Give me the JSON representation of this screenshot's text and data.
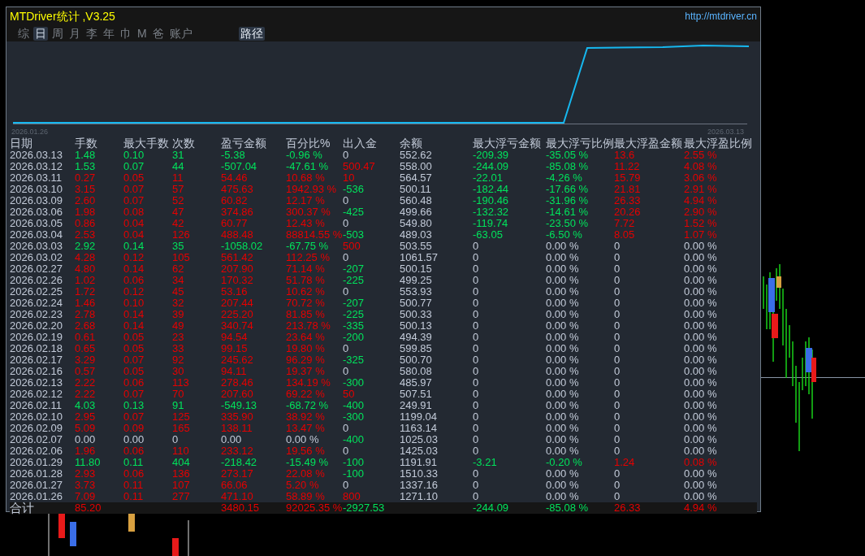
{
  "window": {
    "title": "MTDriver统计 ,V3.25",
    "link": "http://mtdriver.cn"
  },
  "tabs": [
    {
      "label": "综",
      "selected": false
    },
    {
      "label": "日",
      "selected": true
    },
    {
      "label": "周",
      "selected": false
    },
    {
      "label": "月",
      "selected": false
    },
    {
      "label": "李",
      "selected": false
    },
    {
      "label": "年",
      "selected": false
    },
    {
      "label": "巾",
      "selected": false
    },
    {
      "label": "M",
      "selected": false
    },
    {
      "label": "爸",
      "selected": false
    },
    {
      "label": "账户",
      "selected": false
    }
  ],
  "path_button": "路径",
  "equity_chart": {
    "start_label": "2026.01.26",
    "end_label": "2026.03.13"
  },
  "table": {
    "columns": [
      "日期",
      "手数",
      "最大手数",
      "次数",
      "盈亏金额",
      "百分比%",
      "出入金",
      "余额",
      "最大浮亏金额",
      "最大浮亏比例",
      "最大浮盈金额",
      "最大浮盈比例"
    ],
    "rows": [
      [
        {
          "text": "2026.03.13",
          "color": "#c3cbd9"
        },
        {
          "text": "1.48",
          "color": "#00e35c"
        },
        {
          "text": "0.10",
          "color": "#00e35c"
        },
        {
          "text": "31",
          "color": "#00e35c"
        },
        {
          "text": "-5.38",
          "color": "#00e35c"
        },
        {
          "text": "-0.96 %",
          "color": "#00e35c"
        },
        {
          "text": "0",
          "color": "#c3cbd9"
        },
        {
          "text": "552.62",
          "color": "#c3cbd9"
        },
        {
          "text": "-209.39",
          "color": "#00e35c"
        },
        {
          "text": "-35.05 %",
          "color": "#00e35c"
        },
        {
          "text": "13.6",
          "color": "#e60000"
        },
        {
          "text": "2.55 %",
          "color": "#e60000"
        }
      ],
      [
        {
          "text": "2026.03.12",
          "color": "#c3cbd9"
        },
        {
          "text": "1.53",
          "color": "#00e35c"
        },
        {
          "text": "0.07",
          "color": "#00e35c"
        },
        {
          "text": "44",
          "color": "#00e35c"
        },
        {
          "text": "-507.04",
          "color": "#00e35c"
        },
        {
          "text": "-47.61 %",
          "color": "#00e35c"
        },
        {
          "text": "500.47",
          "color": "#e60000"
        },
        {
          "text": "558.00",
          "color": "#c3cbd9"
        },
        {
          "text": "-244.09",
          "color": "#00e35c"
        },
        {
          "text": "-85.08 %",
          "color": "#00e35c"
        },
        {
          "text": "11.22",
          "color": "#e60000"
        },
        {
          "text": "4.08 %",
          "color": "#e60000"
        }
      ],
      [
        {
          "text": "2026.03.11",
          "color": "#c3cbd9"
        },
        {
          "text": "0.27",
          "color": "#e60000"
        },
        {
          "text": "0.05",
          "color": "#e60000"
        },
        {
          "text": "11",
          "color": "#e60000"
        },
        {
          "text": "54.46",
          "color": "#e60000"
        },
        {
          "text": "10.68 %",
          "color": "#e60000"
        },
        {
          "text": "10",
          "color": "#e60000"
        },
        {
          "text": "564.57",
          "color": "#c3cbd9"
        },
        {
          "text": "-22.01",
          "color": "#00e35c"
        },
        {
          "text": "-4.26 %",
          "color": "#00e35c"
        },
        {
          "text": "15.79",
          "color": "#e60000"
        },
        {
          "text": "3.06 %",
          "color": "#e60000"
        }
      ],
      [
        {
          "text": "2026.03.10",
          "color": "#c3cbd9"
        },
        {
          "text": "3.15",
          "color": "#e60000"
        },
        {
          "text": "0.07",
          "color": "#e60000"
        },
        {
          "text": "57",
          "color": "#e60000"
        },
        {
          "text": "475.63",
          "color": "#e60000"
        },
        {
          "text": "1942.93 %",
          "color": "#e60000"
        },
        {
          "text": "-536",
          "color": "#00e35c"
        },
        {
          "text": "500.11",
          "color": "#c3cbd9"
        },
        {
          "text": "-182.44",
          "color": "#00e35c"
        },
        {
          "text": "-17.66 %",
          "color": "#00e35c"
        },
        {
          "text": "21.81",
          "color": "#e60000"
        },
        {
          "text": "2.91 %",
          "color": "#e60000"
        }
      ],
      [
        {
          "text": "2026.03.09",
          "color": "#c3cbd9"
        },
        {
          "text": "2.60",
          "color": "#e60000"
        },
        {
          "text": "0.07",
          "color": "#e60000"
        },
        {
          "text": "52",
          "color": "#e60000"
        },
        {
          "text": "60.82",
          "color": "#e60000"
        },
        {
          "text": "12.17 %",
          "color": "#e60000"
        },
        {
          "text": "0",
          "color": "#c3cbd9"
        },
        {
          "text": "560.48",
          "color": "#c3cbd9"
        },
        {
          "text": "-190.46",
          "color": "#00e35c"
        },
        {
          "text": "-31.96 %",
          "color": "#00e35c"
        },
        {
          "text": "26.33",
          "color": "#e60000"
        },
        {
          "text": "4.94 %",
          "color": "#e60000"
        }
      ],
      [
        {
          "text": "2026.03.06",
          "color": "#c3cbd9"
        },
        {
          "text": "1.98",
          "color": "#e60000"
        },
        {
          "text": "0.08",
          "color": "#e60000"
        },
        {
          "text": "47",
          "color": "#e60000"
        },
        {
          "text": "374.86",
          "color": "#e60000"
        },
        {
          "text": "300.37 %",
          "color": "#e60000"
        },
        {
          "text": "-425",
          "color": "#00e35c"
        },
        {
          "text": "499.66",
          "color": "#c3cbd9"
        },
        {
          "text": "-132.32",
          "color": "#00e35c"
        },
        {
          "text": "-14.61 %",
          "color": "#00e35c"
        },
        {
          "text": "20.26",
          "color": "#e60000"
        },
        {
          "text": "2.90 %",
          "color": "#e60000"
        }
      ],
      [
        {
          "text": "2026.03.05",
          "color": "#c3cbd9"
        },
        {
          "text": "0.86",
          "color": "#e60000"
        },
        {
          "text": "0.04",
          "color": "#e60000"
        },
        {
          "text": "42",
          "color": "#e60000"
        },
        {
          "text": "60.77",
          "color": "#e60000"
        },
        {
          "text": "12.43 %",
          "color": "#e60000"
        },
        {
          "text": "0",
          "color": "#c3cbd9"
        },
        {
          "text": "549.80",
          "color": "#c3cbd9"
        },
        {
          "text": "-119.74",
          "color": "#00e35c"
        },
        {
          "text": "-23.50 %",
          "color": "#00e35c"
        },
        {
          "text": "7.72",
          "color": "#e60000"
        },
        {
          "text": "1.52 %",
          "color": "#e60000"
        }
      ],
      [
        {
          "text": "2026.03.04",
          "color": "#c3cbd9"
        },
        {
          "text": "2.53",
          "color": "#e60000"
        },
        {
          "text": "0.04",
          "color": "#e60000"
        },
        {
          "text": "126",
          "color": "#e60000"
        },
        {
          "text": "488.48",
          "color": "#e60000"
        },
        {
          "text": "88814.55 %",
          "color": "#e60000"
        },
        {
          "text": "-503",
          "color": "#00e35c"
        },
        {
          "text": "489.03",
          "color": "#c3cbd9"
        },
        {
          "text": "-63.05",
          "color": "#00e35c"
        },
        {
          "text": "-6.50 %",
          "color": "#00e35c"
        },
        {
          "text": "8.05",
          "color": "#e60000"
        },
        {
          "text": "1.07 %",
          "color": "#e60000"
        }
      ],
      [
        {
          "text": "2026.03.03",
          "color": "#c3cbd9"
        },
        {
          "text": "2.92",
          "color": "#00e35c"
        },
        {
          "text": "0.14",
          "color": "#00e35c"
        },
        {
          "text": "35",
          "color": "#00e35c"
        },
        {
          "text": "-1058.02",
          "color": "#00e35c"
        },
        {
          "text": "-67.75 %",
          "color": "#00e35c"
        },
        {
          "text": "500",
          "color": "#e60000"
        },
        {
          "text": "503.55",
          "color": "#c3cbd9"
        },
        {
          "text": "0",
          "color": "#c3cbd9"
        },
        {
          "text": "0.00 %",
          "color": "#c3cbd9"
        },
        {
          "text": "0",
          "color": "#c3cbd9"
        },
        {
          "text": "0.00 %",
          "color": "#c3cbd9"
        }
      ],
      [
        {
          "text": "2026.03.02",
          "color": "#c3cbd9"
        },
        {
          "text": "4.28",
          "color": "#e60000"
        },
        {
          "text": "0.12",
          "color": "#e60000"
        },
        {
          "text": "105",
          "color": "#e60000"
        },
        {
          "text": "561.42",
          "color": "#e60000"
        },
        {
          "text": "112.25 %",
          "color": "#e60000"
        },
        {
          "text": "0",
          "color": "#c3cbd9"
        },
        {
          "text": "1061.57",
          "color": "#c3cbd9"
        },
        {
          "text": "0",
          "color": "#c3cbd9"
        },
        {
          "text": "0.00 %",
          "color": "#c3cbd9"
        },
        {
          "text": "0",
          "color": "#c3cbd9"
        },
        {
          "text": "0.00 %",
          "color": "#c3cbd9"
        }
      ],
      [
        {
          "text": "2026.02.27",
          "color": "#c3cbd9"
        },
        {
          "text": "4.80",
          "color": "#e60000"
        },
        {
          "text": "0.14",
          "color": "#e60000"
        },
        {
          "text": "62",
          "color": "#e60000"
        },
        {
          "text": "207.90",
          "color": "#e60000"
        },
        {
          "text": "71.14 %",
          "color": "#e60000"
        },
        {
          "text": "-207",
          "color": "#00e35c"
        },
        {
          "text": "500.15",
          "color": "#c3cbd9"
        },
        {
          "text": "0",
          "color": "#c3cbd9"
        },
        {
          "text": "0.00 %",
          "color": "#c3cbd9"
        },
        {
          "text": "0",
          "color": "#c3cbd9"
        },
        {
          "text": "0.00 %",
          "color": "#c3cbd9"
        }
      ],
      [
        {
          "text": "2026.02.26",
          "color": "#c3cbd9"
        },
        {
          "text": "1.02",
          "color": "#e60000"
        },
        {
          "text": "0.06",
          "color": "#e60000"
        },
        {
          "text": "34",
          "color": "#e60000"
        },
        {
          "text": "170.32",
          "color": "#e60000"
        },
        {
          "text": "51.78 %",
          "color": "#e60000"
        },
        {
          "text": "-225",
          "color": "#00e35c"
        },
        {
          "text": "499.25",
          "color": "#c3cbd9"
        },
        {
          "text": "0",
          "color": "#c3cbd9"
        },
        {
          "text": "0.00 %",
          "color": "#c3cbd9"
        },
        {
          "text": "0",
          "color": "#c3cbd9"
        },
        {
          "text": "0.00 %",
          "color": "#c3cbd9"
        }
      ],
      [
        {
          "text": "2026.02.25",
          "color": "#c3cbd9"
        },
        {
          "text": "1.72",
          "color": "#e60000"
        },
        {
          "text": "0.12",
          "color": "#e60000"
        },
        {
          "text": "45",
          "color": "#e60000"
        },
        {
          "text": "53.16",
          "color": "#e60000"
        },
        {
          "text": "10.62 %",
          "color": "#e60000"
        },
        {
          "text": "0",
          "color": "#c3cbd9"
        },
        {
          "text": "553.93",
          "color": "#c3cbd9"
        },
        {
          "text": "0",
          "color": "#c3cbd9"
        },
        {
          "text": "0.00 %",
          "color": "#c3cbd9"
        },
        {
          "text": "0",
          "color": "#c3cbd9"
        },
        {
          "text": "0.00 %",
          "color": "#c3cbd9"
        }
      ],
      [
        {
          "text": "2026.02.24",
          "color": "#c3cbd9"
        },
        {
          "text": "1.46",
          "color": "#e60000"
        },
        {
          "text": "0.10",
          "color": "#e60000"
        },
        {
          "text": "32",
          "color": "#e60000"
        },
        {
          "text": "207.44",
          "color": "#e60000"
        },
        {
          "text": "70.72 %",
          "color": "#e60000"
        },
        {
          "text": "-207",
          "color": "#00e35c"
        },
        {
          "text": "500.77",
          "color": "#c3cbd9"
        },
        {
          "text": "0",
          "color": "#c3cbd9"
        },
        {
          "text": "0.00 %",
          "color": "#c3cbd9"
        },
        {
          "text": "0",
          "color": "#c3cbd9"
        },
        {
          "text": "0.00 %",
          "color": "#c3cbd9"
        }
      ],
      [
        {
          "text": "2026.02.23",
          "color": "#c3cbd9"
        },
        {
          "text": "2.78",
          "color": "#e60000"
        },
        {
          "text": "0.14",
          "color": "#e60000"
        },
        {
          "text": "39",
          "color": "#e60000"
        },
        {
          "text": "225.20",
          "color": "#e60000"
        },
        {
          "text": "81.85 %",
          "color": "#e60000"
        },
        {
          "text": "-225",
          "color": "#00e35c"
        },
        {
          "text": "500.33",
          "color": "#c3cbd9"
        },
        {
          "text": "0",
          "color": "#c3cbd9"
        },
        {
          "text": "0.00 %",
          "color": "#c3cbd9"
        },
        {
          "text": "0",
          "color": "#c3cbd9"
        },
        {
          "text": "0.00 %",
          "color": "#c3cbd9"
        }
      ],
      [
        {
          "text": "2026.02.20",
          "color": "#c3cbd9"
        },
        {
          "text": "2.68",
          "color": "#e60000"
        },
        {
          "text": "0.14",
          "color": "#e60000"
        },
        {
          "text": "49",
          "color": "#e60000"
        },
        {
          "text": "340.74",
          "color": "#e60000"
        },
        {
          "text": "213.78 %",
          "color": "#e60000"
        },
        {
          "text": "-335",
          "color": "#00e35c"
        },
        {
          "text": "500.13",
          "color": "#c3cbd9"
        },
        {
          "text": "0",
          "color": "#c3cbd9"
        },
        {
          "text": "0.00 %",
          "color": "#c3cbd9"
        },
        {
          "text": "0",
          "color": "#c3cbd9"
        },
        {
          "text": "0.00 %",
          "color": "#c3cbd9"
        }
      ],
      [
        {
          "text": "2026.02.19",
          "color": "#c3cbd9"
        },
        {
          "text": "0.61",
          "color": "#e60000"
        },
        {
          "text": "0.05",
          "color": "#e60000"
        },
        {
          "text": "23",
          "color": "#e60000"
        },
        {
          "text": "94.54",
          "color": "#e60000"
        },
        {
          "text": "23.64 %",
          "color": "#e60000"
        },
        {
          "text": "-200",
          "color": "#00e35c"
        },
        {
          "text": "494.39",
          "color": "#c3cbd9"
        },
        {
          "text": "0",
          "color": "#c3cbd9"
        },
        {
          "text": "0.00 %",
          "color": "#c3cbd9"
        },
        {
          "text": "0",
          "color": "#c3cbd9"
        },
        {
          "text": "0.00 %",
          "color": "#c3cbd9"
        }
      ],
      [
        {
          "text": "2026.02.18",
          "color": "#c3cbd9"
        },
        {
          "text": "0.65",
          "color": "#e60000"
        },
        {
          "text": "0.05",
          "color": "#e60000"
        },
        {
          "text": "33",
          "color": "#e60000"
        },
        {
          "text": "99.15",
          "color": "#e60000"
        },
        {
          "text": "19.80 %",
          "color": "#e60000"
        },
        {
          "text": "0",
          "color": "#c3cbd9"
        },
        {
          "text": "599.85",
          "color": "#c3cbd9"
        },
        {
          "text": "0",
          "color": "#c3cbd9"
        },
        {
          "text": "0.00 %",
          "color": "#c3cbd9"
        },
        {
          "text": "0",
          "color": "#c3cbd9"
        },
        {
          "text": "0.00 %",
          "color": "#c3cbd9"
        }
      ],
      [
        {
          "text": "2026.02.17",
          "color": "#c3cbd9"
        },
        {
          "text": "3.29",
          "color": "#e60000"
        },
        {
          "text": "0.07",
          "color": "#e60000"
        },
        {
          "text": "92",
          "color": "#e60000"
        },
        {
          "text": "245.62",
          "color": "#e60000"
        },
        {
          "text": "96.29 %",
          "color": "#e60000"
        },
        {
          "text": "-325",
          "color": "#00e35c"
        },
        {
          "text": "500.70",
          "color": "#c3cbd9"
        },
        {
          "text": "0",
          "color": "#c3cbd9"
        },
        {
          "text": "0.00 %",
          "color": "#c3cbd9"
        },
        {
          "text": "0",
          "color": "#c3cbd9"
        },
        {
          "text": "0.00 %",
          "color": "#c3cbd9"
        }
      ],
      [
        {
          "text": "2026.02.16",
          "color": "#c3cbd9"
        },
        {
          "text": "0.57",
          "color": "#e60000"
        },
        {
          "text": "0.05",
          "color": "#e60000"
        },
        {
          "text": "30",
          "color": "#e60000"
        },
        {
          "text": "94.11",
          "color": "#e60000"
        },
        {
          "text": "19.37 %",
          "color": "#e60000"
        },
        {
          "text": "0",
          "color": "#c3cbd9"
        },
        {
          "text": "580.08",
          "color": "#c3cbd9"
        },
        {
          "text": "0",
          "color": "#c3cbd9"
        },
        {
          "text": "0.00 %",
          "color": "#c3cbd9"
        },
        {
          "text": "0",
          "color": "#c3cbd9"
        },
        {
          "text": "0.00 %",
          "color": "#c3cbd9"
        }
      ],
      [
        {
          "text": "2026.02.13",
          "color": "#c3cbd9"
        },
        {
          "text": "2.22",
          "color": "#e60000"
        },
        {
          "text": "0.06",
          "color": "#e60000"
        },
        {
          "text": "113",
          "color": "#e60000"
        },
        {
          "text": "278.46",
          "color": "#e60000"
        },
        {
          "text": "134.19 %",
          "color": "#e60000"
        },
        {
          "text": "-300",
          "color": "#00e35c"
        },
        {
          "text": "485.97",
          "color": "#c3cbd9"
        },
        {
          "text": "0",
          "color": "#c3cbd9"
        },
        {
          "text": "0.00 %",
          "color": "#c3cbd9"
        },
        {
          "text": "0",
          "color": "#c3cbd9"
        },
        {
          "text": "0.00 %",
          "color": "#c3cbd9"
        }
      ],
      [
        {
          "text": "2026.02.12",
          "color": "#c3cbd9"
        },
        {
          "text": "2.22",
          "color": "#e60000"
        },
        {
          "text": "0.07",
          "color": "#e60000"
        },
        {
          "text": "70",
          "color": "#e60000"
        },
        {
          "text": "207.60",
          "color": "#e60000"
        },
        {
          "text": "69.22 %",
          "color": "#e60000"
        },
        {
          "text": "50",
          "color": "#e60000"
        },
        {
          "text": "507.51",
          "color": "#c3cbd9"
        },
        {
          "text": "0",
          "color": "#c3cbd9"
        },
        {
          "text": "0.00 %",
          "color": "#c3cbd9"
        },
        {
          "text": "0",
          "color": "#c3cbd9"
        },
        {
          "text": "0.00 %",
          "color": "#c3cbd9"
        }
      ],
      [
        {
          "text": "2026.02.11",
          "color": "#c3cbd9"
        },
        {
          "text": "4.03",
          "color": "#00e35c"
        },
        {
          "text": "0.13",
          "color": "#00e35c"
        },
        {
          "text": "91",
          "color": "#00e35c"
        },
        {
          "text": "-549.13",
          "color": "#00e35c"
        },
        {
          "text": "-68.72 %",
          "color": "#00e35c"
        },
        {
          "text": "-400",
          "color": "#00e35c"
        },
        {
          "text": "249.91",
          "color": "#c3cbd9"
        },
        {
          "text": "0",
          "color": "#c3cbd9"
        },
        {
          "text": "0.00 %",
          "color": "#c3cbd9"
        },
        {
          "text": "0",
          "color": "#c3cbd9"
        },
        {
          "text": "0.00 %",
          "color": "#c3cbd9"
        }
      ],
      [
        {
          "text": "2026.02.10",
          "color": "#c3cbd9"
        },
        {
          "text": "2.95",
          "color": "#e60000"
        },
        {
          "text": "0.07",
          "color": "#e60000"
        },
        {
          "text": "125",
          "color": "#e60000"
        },
        {
          "text": "335.90",
          "color": "#e60000"
        },
        {
          "text": "38.92 %",
          "color": "#e60000"
        },
        {
          "text": "-300",
          "color": "#00e35c"
        },
        {
          "text": "1199.04",
          "color": "#c3cbd9"
        },
        {
          "text": "0",
          "color": "#c3cbd9"
        },
        {
          "text": "0.00 %",
          "color": "#c3cbd9"
        },
        {
          "text": "0",
          "color": "#c3cbd9"
        },
        {
          "text": "0.00 %",
          "color": "#c3cbd9"
        }
      ],
      [
        {
          "text": "2026.02.09",
          "color": "#c3cbd9"
        },
        {
          "text": "5.09",
          "color": "#e60000"
        },
        {
          "text": "0.09",
          "color": "#e60000"
        },
        {
          "text": "165",
          "color": "#e60000"
        },
        {
          "text": "138.11",
          "color": "#e60000"
        },
        {
          "text": "13.47 %",
          "color": "#e60000"
        },
        {
          "text": "0",
          "color": "#c3cbd9"
        },
        {
          "text": "1163.14",
          "color": "#c3cbd9"
        },
        {
          "text": "0",
          "color": "#c3cbd9"
        },
        {
          "text": "0.00 %",
          "color": "#c3cbd9"
        },
        {
          "text": "0",
          "color": "#c3cbd9"
        },
        {
          "text": "0.00 %",
          "color": "#c3cbd9"
        }
      ],
      [
        {
          "text": "2026.02.07",
          "color": "#c3cbd9"
        },
        {
          "text": "0.00",
          "color": "#c3cbd9"
        },
        {
          "text": "0.00",
          "color": "#c3cbd9"
        },
        {
          "text": "0",
          "color": "#c3cbd9"
        },
        {
          "text": "0.00",
          "color": "#c3cbd9"
        },
        {
          "text": "0.00 %",
          "color": "#c3cbd9"
        },
        {
          "text": "-400",
          "color": "#00e35c"
        },
        {
          "text": "1025.03",
          "color": "#c3cbd9"
        },
        {
          "text": "0",
          "color": "#c3cbd9"
        },
        {
          "text": "0.00 %",
          "color": "#c3cbd9"
        },
        {
          "text": "0",
          "color": "#c3cbd9"
        },
        {
          "text": "0.00 %",
          "color": "#c3cbd9"
        }
      ],
      [
        {
          "text": "2026.02.06",
          "color": "#c3cbd9"
        },
        {
          "text": "1.96",
          "color": "#e60000"
        },
        {
          "text": "0.06",
          "color": "#e60000"
        },
        {
          "text": "110",
          "color": "#e60000"
        },
        {
          "text": "233.12",
          "color": "#e60000"
        },
        {
          "text": "19.56 %",
          "color": "#e60000"
        },
        {
          "text": "0",
          "color": "#c3cbd9"
        },
        {
          "text": "1425.03",
          "color": "#c3cbd9"
        },
        {
          "text": "0",
          "color": "#c3cbd9"
        },
        {
          "text": "0.00 %",
          "color": "#c3cbd9"
        },
        {
          "text": "0",
          "color": "#c3cbd9"
        },
        {
          "text": "0.00 %",
          "color": "#c3cbd9"
        }
      ],
      [
        {
          "text": "2026.01.29",
          "color": "#c3cbd9"
        },
        {
          "text": "11.80",
          "color": "#00e35c"
        },
        {
          "text": "0.11",
          "color": "#00e35c"
        },
        {
          "text": "404",
          "color": "#00e35c"
        },
        {
          "text": "-218.42",
          "color": "#00e35c"
        },
        {
          "text": "-15.49 %",
          "color": "#00e35c"
        },
        {
          "text": "-100",
          "color": "#00e35c"
        },
        {
          "text": "1191.91",
          "color": "#c3cbd9"
        },
        {
          "text": "-3.21",
          "color": "#00e35c"
        },
        {
          "text": "-0.20 %",
          "color": "#00e35c"
        },
        {
          "text": "1.24",
          "color": "#e60000"
        },
        {
          "text": "0.08 %",
          "color": "#e60000"
        }
      ],
      [
        {
          "text": "2026.01.28",
          "color": "#c3cbd9"
        },
        {
          "text": "2.93",
          "color": "#e60000"
        },
        {
          "text": "0.06",
          "color": "#e60000"
        },
        {
          "text": "136",
          "color": "#e60000"
        },
        {
          "text": "273.17",
          "color": "#e60000"
        },
        {
          "text": "22.08 %",
          "color": "#e60000"
        },
        {
          "text": "-100",
          "color": "#00e35c"
        },
        {
          "text": "1510.33",
          "color": "#c3cbd9"
        },
        {
          "text": "0",
          "color": "#c3cbd9"
        },
        {
          "text": "0.00 %",
          "color": "#c3cbd9"
        },
        {
          "text": "0",
          "color": "#c3cbd9"
        },
        {
          "text": "0.00 %",
          "color": "#c3cbd9"
        }
      ],
      [
        {
          "text": "2026.01.27",
          "color": "#c3cbd9"
        },
        {
          "text": "3.73",
          "color": "#e60000"
        },
        {
          "text": "0.11",
          "color": "#e60000"
        },
        {
          "text": "107",
          "color": "#e60000"
        },
        {
          "text": "66.06",
          "color": "#e60000"
        },
        {
          "text": "5.20 %",
          "color": "#e60000"
        },
        {
          "text": "0",
          "color": "#c3cbd9"
        },
        {
          "text": "1337.16",
          "color": "#c3cbd9"
        },
        {
          "text": "0",
          "color": "#c3cbd9"
        },
        {
          "text": "0.00 %",
          "color": "#c3cbd9"
        },
        {
          "text": "0",
          "color": "#c3cbd9"
        },
        {
          "text": "0.00 %",
          "color": "#c3cbd9"
        }
      ],
      [
        {
          "text": "2026.01.26",
          "color": "#c3cbd9"
        },
        {
          "text": "7.09",
          "color": "#e60000"
        },
        {
          "text": "0.11",
          "color": "#e60000"
        },
        {
          "text": "277",
          "color": "#e60000"
        },
        {
          "text": "471.10",
          "color": "#e60000"
        },
        {
          "text": "58.89 %",
          "color": "#e60000"
        },
        {
          "text": "800",
          "color": "#e60000"
        },
        {
          "text": "1271.10",
          "color": "#c3cbd9"
        },
        {
          "text": "0",
          "color": "#c3cbd9"
        },
        {
          "text": "0.00 %",
          "color": "#c3cbd9"
        },
        {
          "text": "0",
          "color": "#c3cbd9"
        },
        {
          "text": "0.00 %",
          "color": "#c3cbd9"
        }
      ]
    ],
    "total": {
      "label": {
        "text": "合计",
        "color": "#c3cbd9"
      },
      "lots": {
        "text": "85.20",
        "color": "#e60000"
      },
      "profit": {
        "text": "3480.15",
        "color": "#e60000"
      },
      "percent": {
        "text": "92025.35 %",
        "color": "#e60000"
      },
      "cash_flow": {
        "text": "-2927.53",
        "color": "#00e35c"
      },
      "max_float_loss": {
        "text": "-244.09",
        "color": "#00e35c"
      },
      "max_float_loss_ratio": {
        "text": "-85.08 %",
        "color": "#00e35c"
      },
      "max_float_profit": {
        "text": "26.33",
        "color": "#e60000"
      },
      "max_float_profit_ratio": {
        "text": "4.94 %",
        "color": "#e60000"
      }
    }
  }
}
